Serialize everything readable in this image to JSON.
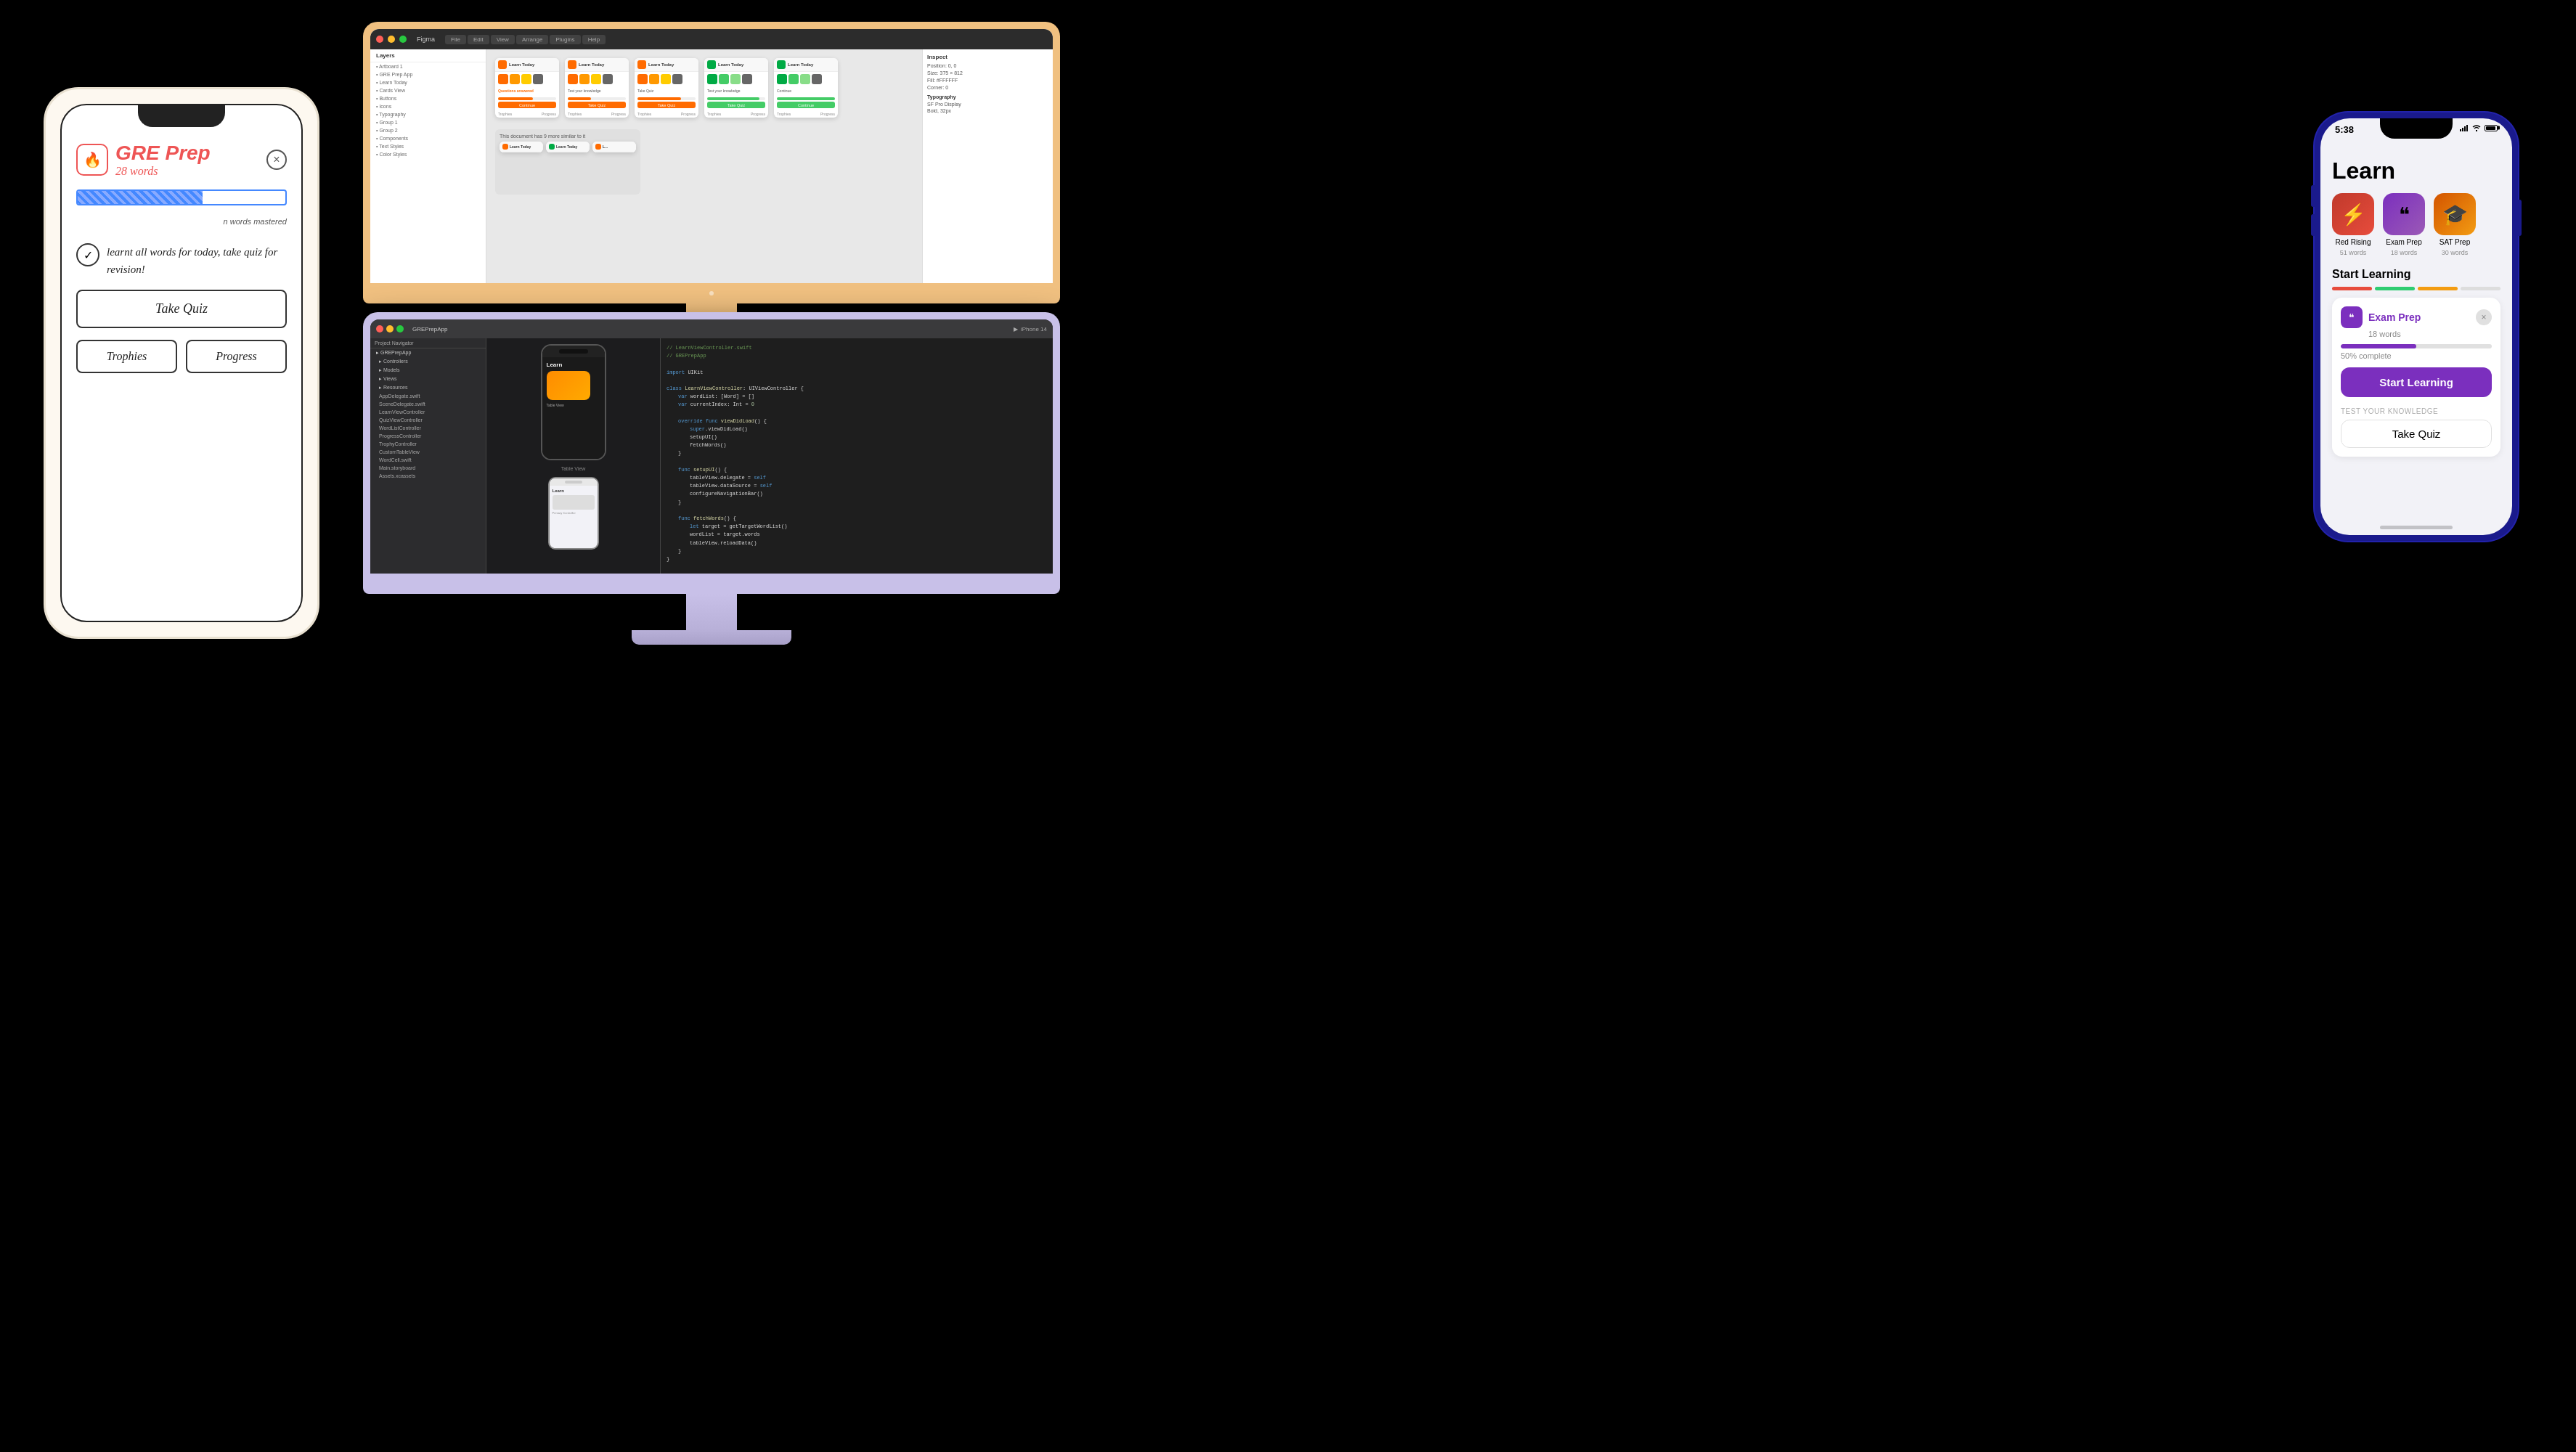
{
  "background": "#000000",
  "sketch": {
    "title": "GRE Prep",
    "subtitle": "28 words",
    "close_label": "×",
    "progress_label": "n words mastered",
    "message": "learnt all words for today, take quiz for revision!",
    "check_symbol": "✓",
    "btn_quiz": "Take Quiz",
    "btn_trophies": "Trophies",
    "btn_progress": "Progress"
  },
  "imac_top": {
    "screen_type": "figma",
    "tab1": "Figma",
    "cards": [
      {
        "title": "Learn Today",
        "type": "orange"
      },
      {
        "title": "Learn Today",
        "type": "orange"
      },
      {
        "title": "Learn Today",
        "type": "orange"
      },
      {
        "title": "Learn Today",
        "type": "green"
      },
      {
        "title": "Learn Today",
        "type": "green"
      }
    ]
  },
  "imac_bottom": {
    "screen_type": "xcode",
    "preview_label": "Table View",
    "preview_sublabel": "Primary Controller"
  },
  "iphone": {
    "status_time": "5:38",
    "status_signal": "●●●●",
    "status_wifi": "WiFi",
    "status_battery": "🔋",
    "page_title": "Learn",
    "apps": [
      {
        "name": "Red Rising",
        "words": "51 words",
        "icon": "⚡"
      },
      {
        "name": "Exam Prep",
        "words": "18 words",
        "icon": "❝"
      },
      {
        "name": "SAT Prep",
        "words": "30 words",
        "icon": "🎓"
      }
    ],
    "section_title": "Start Learning",
    "active_card": {
      "icon": "❝",
      "title": "Exam Prep",
      "words": "18 words",
      "progress_percent": "50% complete",
      "close": "×"
    },
    "start_learning_btn": "Start Learning",
    "test_knowledge_label": "TEST YOUR KNOWLEDGE",
    "take_quiz_btn": "Take Quiz"
  }
}
